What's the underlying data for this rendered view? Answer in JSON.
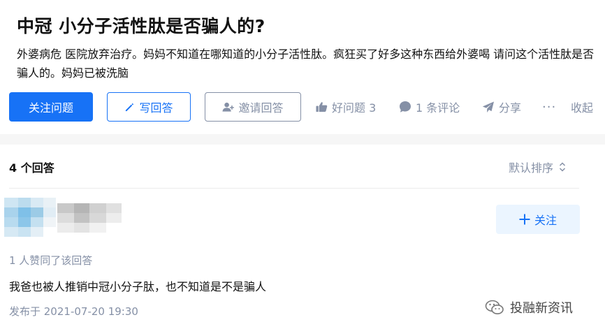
{
  "question": {
    "title": "中冠 小分子活性肽是否骗人的?",
    "description": "外婆病危 医院放弃治疗。妈妈不知道在哪知道的小分子活性肽。疯狂买了好多这种东西给外婆喝 请问这个活性肽是否骗人的。妈妈已被洗脑"
  },
  "actions": {
    "follow_label": "关注问题",
    "write_label": "写回答",
    "invite_label": "邀请回答",
    "good_question_label": "好问题 3",
    "comment_label": "1 条评论",
    "share_label": "分享",
    "more_label": "···",
    "fold_label": "收起"
  },
  "answers": {
    "count_label": "4 个回答",
    "sort_label": "默认排序",
    "items": [
      {
        "follow_label": "关注",
        "likes_text": "1 人赞同了该回答",
        "content": "我爸也被人推销中冠小分子肽，也不知道是不是骗人",
        "published": "发布于 2021-07-20 19:30"
      }
    ]
  },
  "watermark": {
    "text": "投融新资讯"
  },
  "colors": {
    "primary": "#1772f6",
    "muted": "#8590a6",
    "follow_bg": "#ebf5ff"
  },
  "icons": [
    "pencil-icon",
    "invite-user-icon",
    "thumb-up-icon",
    "comment-bubble-icon",
    "share-paper-plane-icon",
    "sort-chevron-icon",
    "plus-icon",
    "wechat-icon"
  ]
}
